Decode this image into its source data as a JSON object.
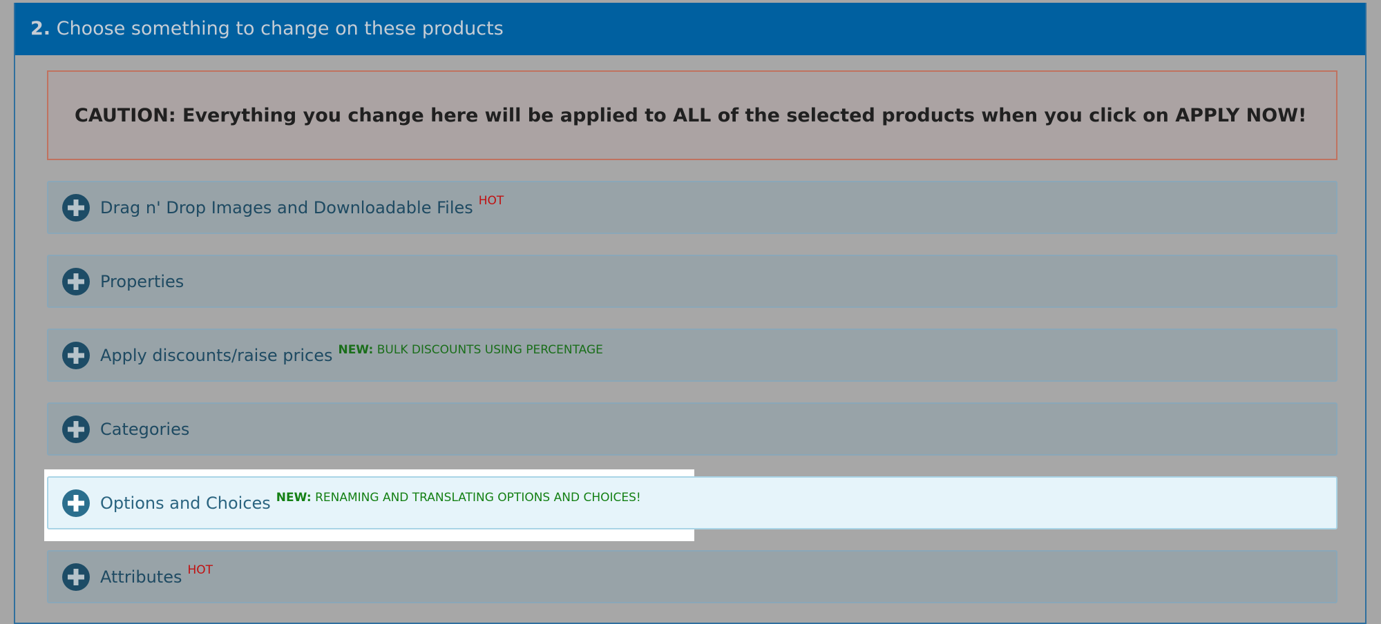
{
  "header": {
    "step_number": "2.",
    "title": "Choose something to change on these products"
  },
  "caution": {
    "text": "CAUTION: Everything you change here will be applied to ALL of the selected products when you click on APPLY NOW!"
  },
  "sections": [
    {
      "label": "Drag n' Drop Images and Downloadable Files",
      "badge": "HOT"
    },
    {
      "label": "Properties"
    },
    {
      "label": "Apply discounts/raise prices",
      "new_prefix": "NEW:",
      "new_text": "BULK DISCOUNTS USING PERCENTAGE"
    },
    {
      "label": "Categories"
    },
    {
      "label": "Options and Choices",
      "new_prefix": "NEW:",
      "new_text": "RENAMING AND TRANSLATING OPTIONS AND CHOICES!"
    },
    {
      "label": "Attributes",
      "badge": "HOT"
    }
  ],
  "icons": {
    "expand": "plus-circle-icon"
  },
  "colors": {
    "header_bg": "#0060a0",
    "hot": "#c01010",
    "new": "#148014"
  }
}
